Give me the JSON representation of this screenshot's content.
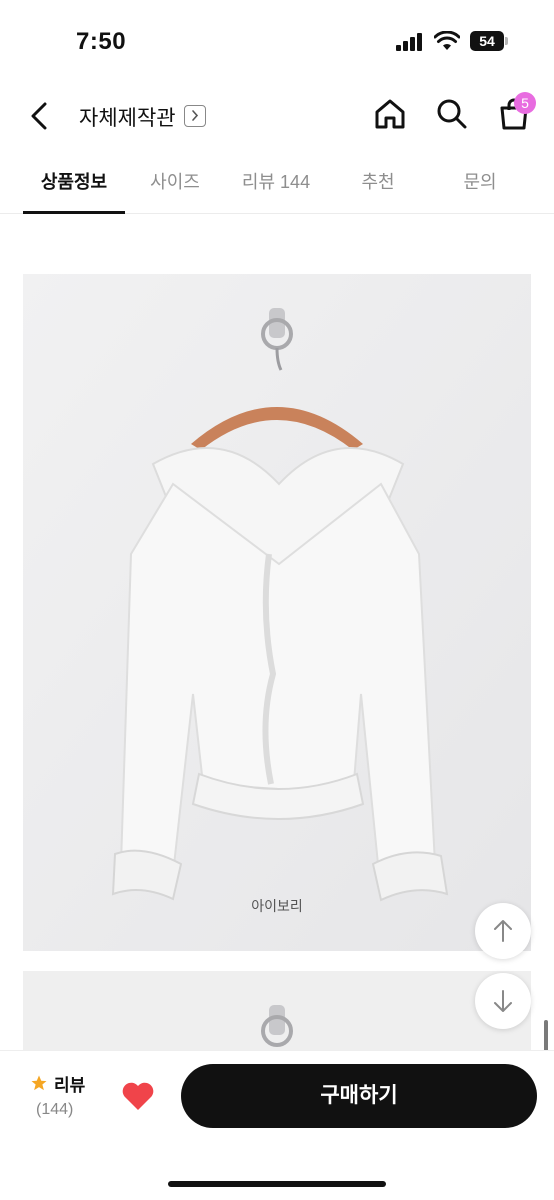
{
  "status_bar": {
    "time": "7:50",
    "battery": "54"
  },
  "header": {
    "store_title": "자체제작관",
    "icons": {
      "back": "chevron-left-icon",
      "store_link": "chevron-right-icon",
      "home": "home-icon",
      "search": "search-icon",
      "bag": "shopping-bag-icon"
    },
    "cart_count": "5"
  },
  "tabs": [
    {
      "label": "상품정보",
      "active": true
    },
    {
      "label": "사이즈",
      "active": false
    },
    {
      "label": "리뷰 144",
      "active": false
    },
    {
      "label": "추천",
      "active": false
    },
    {
      "label": "문의",
      "active": false
    }
  ],
  "product": {
    "color_caption": "아이보리"
  },
  "bottom_bar": {
    "review_label": "리뷰",
    "review_count": "(144)",
    "buy_label": "구매하기"
  },
  "colors": {
    "accent_badge": "#e86ce0",
    "heart": "#f0444a",
    "star": "#f5a623",
    "buy_button": "#111111"
  }
}
